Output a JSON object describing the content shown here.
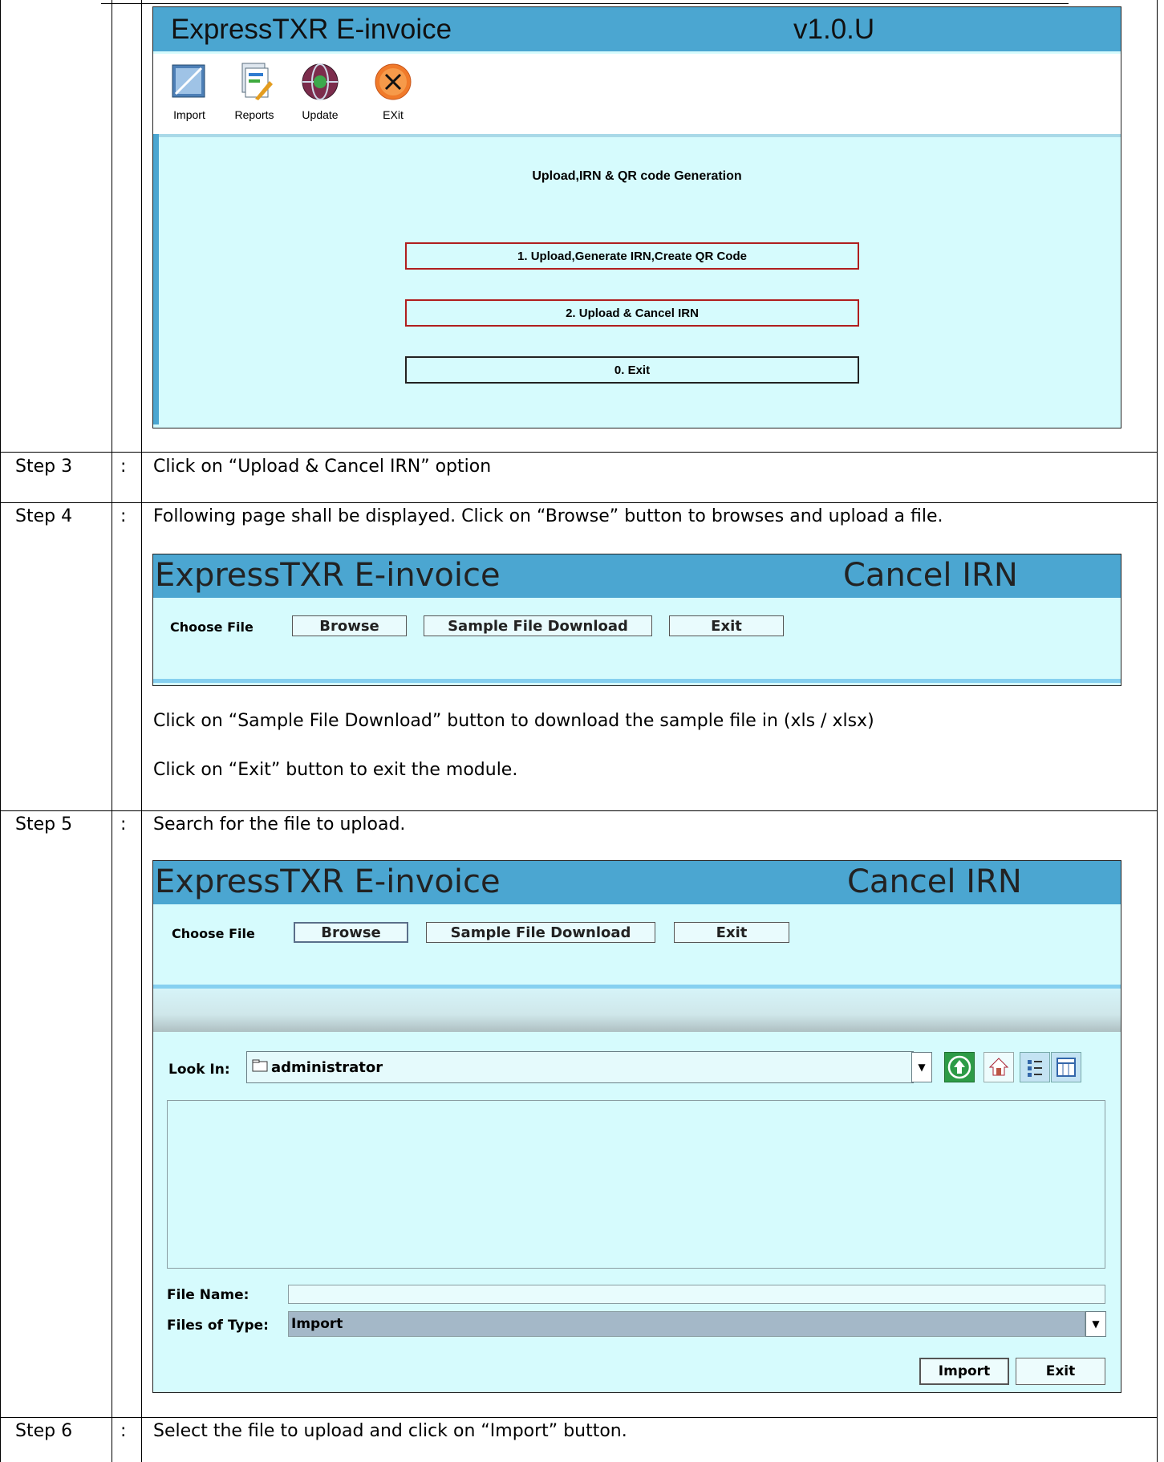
{
  "screen1": {
    "app_title": "ExpressTXR E-invoice",
    "version": "v1.0.U",
    "toolbar": [
      {
        "label": "Import",
        "icon": "import-icon"
      },
      {
        "label": "Reports",
        "icon": "reports-icon"
      },
      {
        "label": "Update",
        "icon": "update-globe-icon"
      },
      {
        "label": "EXit",
        "icon": "exit-icon"
      }
    ],
    "section_title": "Upload,IRN & QR code Generation",
    "menu": [
      "1. Upload,Generate IRN,Create QR Code",
      "2. Upload & Cancel IRN",
      "0. Exit"
    ]
  },
  "steps": [
    {
      "label": "Step 3",
      "colon": ":",
      "text": "Click on “Upload & Cancel IRN” option"
    },
    {
      "label": "Step 4",
      "colon": ":",
      "text": "Following page shall be displayed. Click on “Browse” button to browses and upload a file.",
      "notes": [
        "Click on “Sample File Download” button to download the sample file in (xls / xlsx)",
        "Click on “Exit” button to exit the module."
      ]
    },
    {
      "label": "Step 5",
      "colon": ":",
      "text": "Search for the file to upload."
    },
    {
      "label": "Step 6",
      "colon": ":",
      "text": "Select the file to upload and click on “Import” button."
    }
  ],
  "cancel_screen": {
    "app_title": "ExpressTXR E-invoice",
    "module_title": "Cancel IRN",
    "choose_file_label": "Choose File",
    "browse_label": "Browse",
    "sample_label": "Sample File Download",
    "exit_label": "Exit"
  },
  "file_dialog": {
    "look_in_label": "Look In:",
    "look_in_value": "administrator",
    "file_name_label": "File Name:",
    "file_name_value": "",
    "files_of_type_label": "Files of Type:",
    "files_of_type_value": "Import",
    "import_label": "Import",
    "exit_label": "Exit",
    "icons": [
      "up-folder-icon",
      "home-icon",
      "list-view-icon",
      "details-view-icon"
    ]
  },
  "colors": {
    "titlebar": "#4ba6d1",
    "panel": "#d6fbfd",
    "menu_border_red": "#b01e1e",
    "select_bg": "#a4b8c8"
  }
}
